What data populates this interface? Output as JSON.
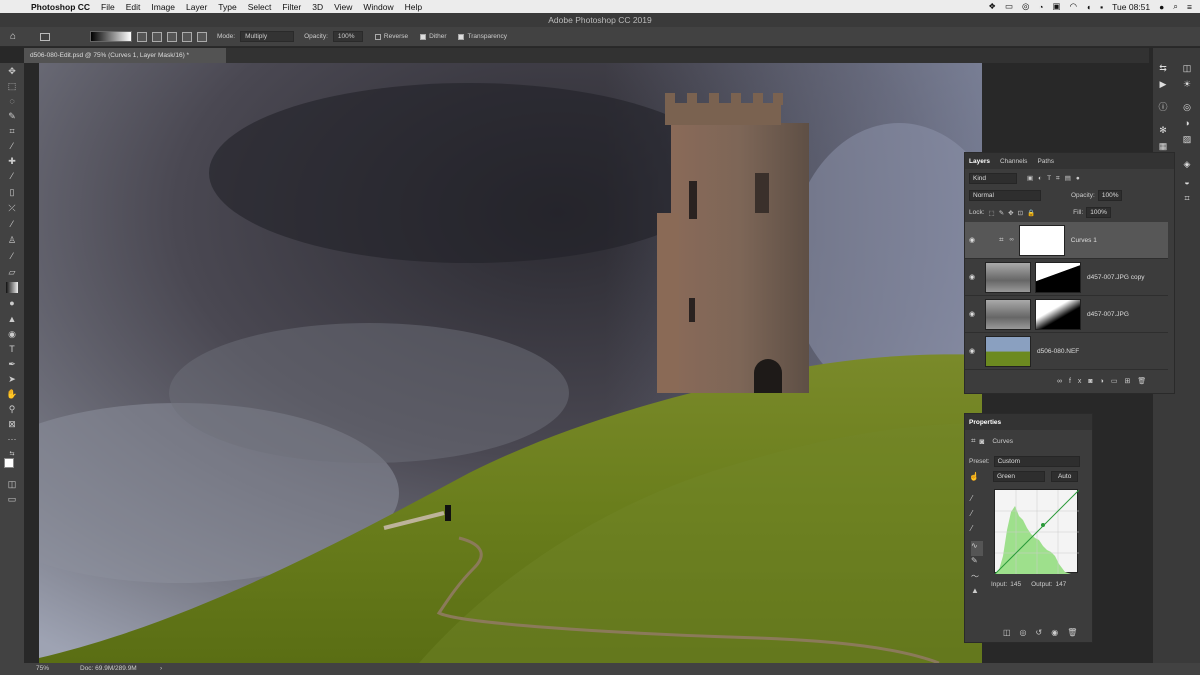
{
  "menubar": {
    "app": "Photoshop CC",
    "items": [
      "File",
      "Edit",
      "Image",
      "Layer",
      "Type",
      "Select",
      "Filter",
      "3D",
      "View",
      "Window",
      "Help"
    ],
    "clock": "Tue 08:51"
  },
  "window": {
    "title": "Adobe Photoshop CC 2019"
  },
  "options": {
    "mode_label": "Mode:",
    "mode_value": "Multiply",
    "opacity_label": "Opacity:",
    "opacity_value": "100%",
    "reverse": "Reverse",
    "dither": "Dither",
    "transparency": "Transparency"
  },
  "document": {
    "tab": "d506-080-Edit.psd @ 75% (Curves 1, Layer Mask/16) *"
  },
  "status": {
    "zoom": "75%",
    "doc": "Doc: 69.9M/289.9M",
    "arrow": "›"
  },
  "layers_panel": {
    "tabs": [
      "Layers",
      "Channels",
      "Paths"
    ],
    "kind": "Kind",
    "blend": "Normal",
    "opacity_label": "Opacity:",
    "opacity_value": "100%",
    "lock_label": "Lock:",
    "fill_label": "Fill:",
    "fill_value": "100%",
    "layers": [
      {
        "name": "Curves 1",
        "selected": true
      },
      {
        "name": "d457-007.JPG copy",
        "selected": false
      },
      {
        "name": "d457-007.JPG",
        "selected": false
      },
      {
        "name": "d506-080.NEF",
        "selected": false
      }
    ]
  },
  "properties_panel": {
    "title": "Properties",
    "type": "Curves",
    "preset_label": "Preset:",
    "preset_value": "Custom",
    "channel": "Green",
    "auto": "Auto",
    "input_label": "Input:",
    "input_value": "145",
    "output_label": "Output:",
    "output_value": "147"
  },
  "icons": {
    "eye": "eye-icon",
    "home": "home-icon"
  }
}
